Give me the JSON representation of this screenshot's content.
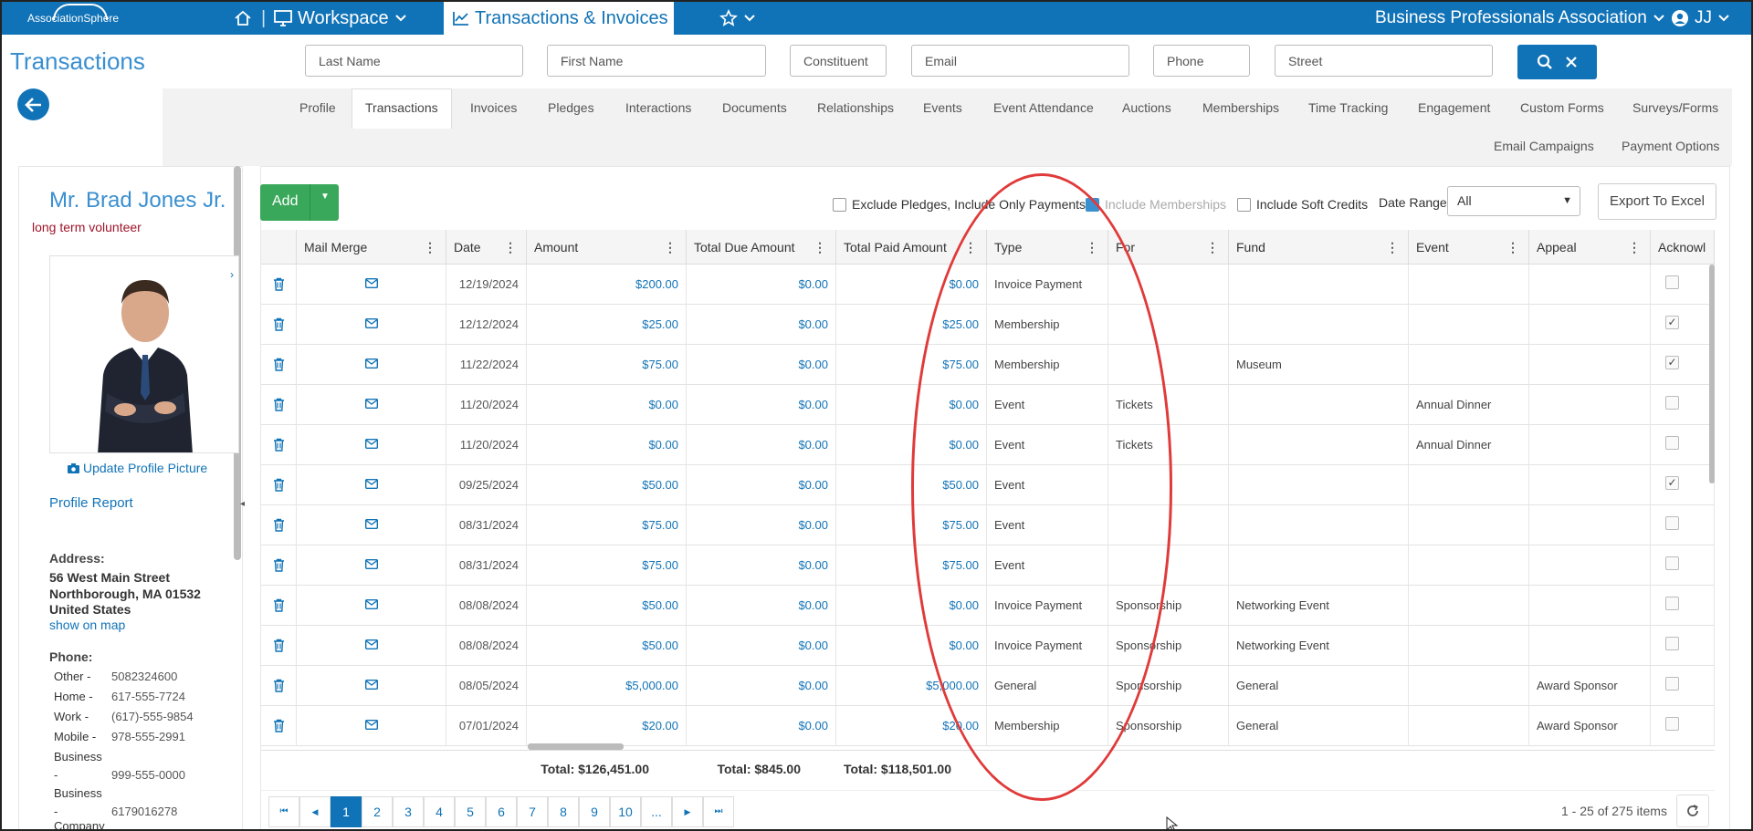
{
  "topbar": {
    "logo_text": "AssociationSphere",
    "workspace_label": "Workspace",
    "module_label": "Transactions & Invoices",
    "org_name": "Business Professionals Association",
    "user_initials": "JJ"
  },
  "page_title": "Transactions",
  "search": {
    "last_name": "Last Name",
    "first_name": "First Name",
    "constituent_id": "Constituent ID",
    "email": "Email",
    "phone": "Phone",
    "street": "Street"
  },
  "tabs_row1": [
    "Profile",
    "Transactions",
    "Invoices",
    "Pledges",
    "Interactions",
    "Documents",
    "Relationships",
    "Events",
    "Event Attendance",
    "Auctions",
    "Memberships",
    "Time Tracking",
    "Engagement",
    "Custom Forms",
    "Surveys/Forms"
  ],
  "tabs_row2": [
    "Email Campaigns",
    "Payment Options"
  ],
  "active_tab": "Transactions",
  "profile": {
    "name": "Mr. Brad Jones Jr.",
    "tag": "long term volunteer",
    "update_picture": "Update Profile Picture",
    "profile_report": "Profile Report",
    "address_label": "Address:",
    "address_line1": "56 West Main Street",
    "address_line2": "Northborough, MA 01532",
    "address_line3": "United States",
    "show_on_map": "show on map",
    "phone_label": "Phone:",
    "phones": [
      {
        "label": "Other -",
        "value": "5082324600"
      },
      {
        "label": "Home -",
        "value": "617-555-7724"
      },
      {
        "label": "Work -",
        "value": "(617)-555-9854"
      },
      {
        "label": "Mobile -",
        "value": "978-555-2991"
      },
      {
        "label": "Business",
        "value": ""
      },
      {
        "label": "-",
        "value": "999-555-0000"
      },
      {
        "label": "Business",
        "value": ""
      },
      {
        "label": "-",
        "value": "6179016278"
      },
      {
        "label": "Company",
        "value": ""
      }
    ]
  },
  "toolbar": {
    "add_label": "Add",
    "exclude_pledges": "Exclude Pledges, Include Only Payments",
    "include_memberships": "Include Memberships",
    "include_soft_credits": "Include Soft Credits",
    "date_range_label": "Date Range",
    "date_range_value": "All",
    "export_label": "Export To Excel"
  },
  "columns": [
    "Mail Merge",
    "Date",
    "Amount",
    "Total Due Amount",
    "Total Paid Amount",
    "Type",
    "For",
    "Fund",
    "Event",
    "Appeal",
    "Acknowl"
  ],
  "rows": [
    {
      "date": "12/19/2024",
      "amount": "$200.00",
      "due": "$0.00",
      "paid": "$0.00",
      "type": "Invoice Payment",
      "for": "",
      "fund": "",
      "event": "",
      "appeal": "",
      "ack": false
    },
    {
      "date": "12/12/2024",
      "amount": "$25.00",
      "due": "$0.00",
      "paid": "$25.00",
      "type": "Membership",
      "for": "",
      "fund": "",
      "event": "",
      "appeal": "",
      "ack": true
    },
    {
      "date": "11/22/2024",
      "amount": "$75.00",
      "due": "$0.00",
      "paid": "$75.00",
      "type": "Membership",
      "for": "",
      "fund": "Museum",
      "event": "",
      "appeal": "",
      "ack": true
    },
    {
      "date": "11/20/2024",
      "amount": "$0.00",
      "due": "$0.00",
      "paid": "$0.00",
      "type": "Event",
      "for": "Tickets",
      "fund": "",
      "event": "Annual Dinner",
      "appeal": "",
      "ack": false
    },
    {
      "date": "11/20/2024",
      "amount": "$0.00",
      "due": "$0.00",
      "paid": "$0.00",
      "type": "Event",
      "for": "Tickets",
      "fund": "",
      "event": "Annual Dinner",
      "appeal": "",
      "ack": false
    },
    {
      "date": "09/25/2024",
      "amount": "$50.00",
      "due": "$0.00",
      "paid": "$50.00",
      "type": "Event",
      "for": "",
      "fund": "",
      "event": "",
      "appeal": "",
      "ack": true
    },
    {
      "date": "08/31/2024",
      "amount": "$75.00",
      "due": "$0.00",
      "paid": "$75.00",
      "type": "Event",
      "for": "",
      "fund": "",
      "event": "",
      "appeal": "",
      "ack": false
    },
    {
      "date": "08/31/2024",
      "amount": "$75.00",
      "due": "$0.00",
      "paid": "$75.00",
      "type": "Event",
      "for": "",
      "fund": "",
      "event": "",
      "appeal": "",
      "ack": false
    },
    {
      "date": "08/08/2024",
      "amount": "$50.00",
      "due": "$0.00",
      "paid": "$0.00",
      "type": "Invoice Payment",
      "for": "Sponsorship",
      "fund": "Networking Event",
      "event": "",
      "appeal": "",
      "ack": false
    },
    {
      "date": "08/08/2024",
      "amount": "$50.00",
      "due": "$0.00",
      "paid": "$0.00",
      "type": "Invoice Payment",
      "for": "Sponsorship",
      "fund": "Networking Event",
      "event": "",
      "appeal": "",
      "ack": false
    },
    {
      "date": "08/05/2024",
      "amount": "$5,000.00",
      "due": "$0.00",
      "paid": "$5,000.00",
      "type": "General",
      "for": "Sponsorship",
      "fund": "General",
      "event": "",
      "appeal": "Award Sponsor",
      "ack": false
    },
    {
      "date": "07/01/2024",
      "amount": "$20.00",
      "due": "$0.00",
      "paid": "$20.00",
      "type": "Membership",
      "for": "Sponsorship",
      "fund": "General",
      "event": "",
      "appeal": "Award Sponsor",
      "ack": false
    }
  ],
  "totals": {
    "amount": "Total: $126,451.00",
    "due": "Total: $845.00",
    "paid": "Total: $118,501.00"
  },
  "pager": {
    "pages": [
      "1",
      "2",
      "3",
      "4",
      "5",
      "6",
      "7",
      "8",
      "9",
      "10",
      "..."
    ],
    "current": "1",
    "info": "1 - 25 of 275 items"
  },
  "colors": {
    "primary": "#1173b7",
    "add_green": "#39a85a",
    "annotation_red": "#e03a3a"
  },
  "icons": [
    "home-icon",
    "monitor-icon",
    "chart-line-icon",
    "star-icon",
    "user-circle-icon",
    "search-icon",
    "close-icon",
    "arrow-left-icon",
    "trash-icon",
    "envelope-icon",
    "camera-icon",
    "refresh-icon"
  ]
}
